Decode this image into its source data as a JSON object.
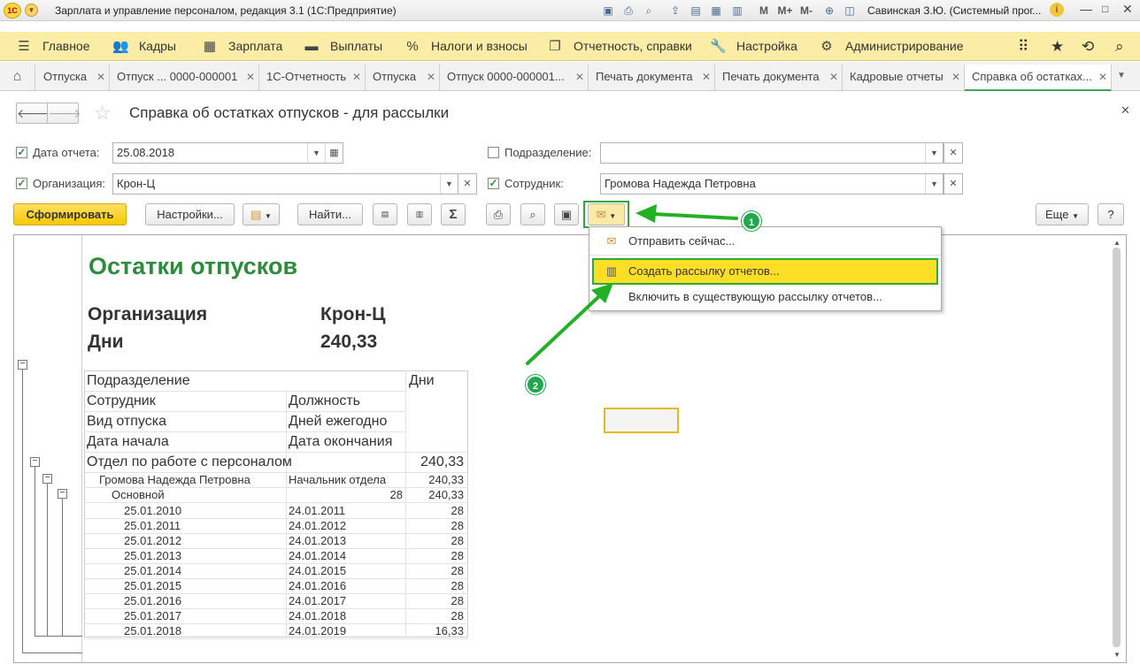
{
  "window": {
    "title": "Зарплата и управление персоналом, редакция 3.1  (1С:Предприятие)",
    "user": "Савинская З.Ю. (Системный прог...",
    "logo_text": "1С"
  },
  "main_menu": [
    {
      "label": "Главное",
      "icon": "hamburger-icon"
    },
    {
      "label": "Кадры",
      "icon": "people-icon"
    },
    {
      "label": "Зарплата",
      "icon": "calculator-icon"
    },
    {
      "label": "Выплаты",
      "icon": "wallet-icon"
    },
    {
      "label": "Налоги и взносы",
      "icon": "percent-icon"
    },
    {
      "label": "Отчетность, справки",
      "icon": "documents-icon"
    },
    {
      "label": "Настройка",
      "icon": "wrench-icon"
    },
    {
      "label": "Администрирование",
      "icon": "gear-icon"
    }
  ],
  "tabs": [
    "Отпуска",
    "Отпуск ... 0000-000001",
    "1С-Отчетность",
    "Отпуска",
    "Отпуск 0000-000001...",
    "Печать документа",
    "Печать документа",
    "Кадровые отчеты",
    "Справка об остатках..."
  ],
  "form": {
    "title": "Справка об остатках отпусков - для рассылки",
    "date_label": "Дата отчета:",
    "date_value": "25.08.2018",
    "org_label": "Организация:",
    "org_value": "Крон-Ц",
    "dept_label": "Подразделение:",
    "dept_value": "",
    "emp_label": "Сотрудник:",
    "emp_value": "Громова Надежда Петровна"
  },
  "toolbar": {
    "generate": "Сформировать",
    "settings": "Настройки...",
    "find": "Найти...",
    "more": "Еще",
    "help": "?",
    "sum": "Σ"
  },
  "dropdown": {
    "send_now": "Отправить сейчас...",
    "create_mailing": "Создать рассылку отчетов...",
    "include_mailing": "Включить в существующую рассылку отчетов..."
  },
  "ui": {
    "arrow_badges": [
      "1",
      "2"
    ]
  },
  "report": {
    "title": "Остатки отпусков",
    "org_label": "Организация",
    "org_value": "Крон-Ц",
    "days_label": "Дни",
    "days_value": "240,33",
    "headers": {
      "dept": "Подразделение",
      "days": "Дни",
      "employee": "Сотрудник",
      "position": "Должность",
      "leave_type": "Вид отпуска",
      "annual_days": "Дней ежегодно",
      "start": "Дата начала",
      "end": "Дата окончания"
    },
    "dept_row": {
      "name": "Отдел по работе с персоналом",
      "days": "240,33"
    },
    "emp_row": {
      "name": "Громова Надежда Петровна",
      "position": "Начальник отдела",
      "days": "240,33"
    },
    "type_row": {
      "name": "Основной",
      "annual": "28",
      "days": "240,33"
    },
    "periods": [
      {
        "start": "25.01.2010",
        "end": "24.01.2011",
        "days": "28"
      },
      {
        "start": "25.01.2011",
        "end": "24.01.2012",
        "days": "28"
      },
      {
        "start": "25.01.2012",
        "end": "24.01.2013",
        "days": "28"
      },
      {
        "start": "25.01.2013",
        "end": "24.01.2014",
        "days": "28"
      },
      {
        "start": "25.01.2014",
        "end": "24.01.2015",
        "days": "28"
      },
      {
        "start": "25.01.2015",
        "end": "24.01.2016",
        "days": "28"
      },
      {
        "start": "25.01.2016",
        "end": "24.01.2017",
        "days": "28"
      },
      {
        "start": "25.01.2017",
        "end": "24.01.2018",
        "days": "28"
      },
      {
        "start": "25.01.2018",
        "end": "24.01.2019",
        "days": "16,33"
      }
    ]
  }
}
